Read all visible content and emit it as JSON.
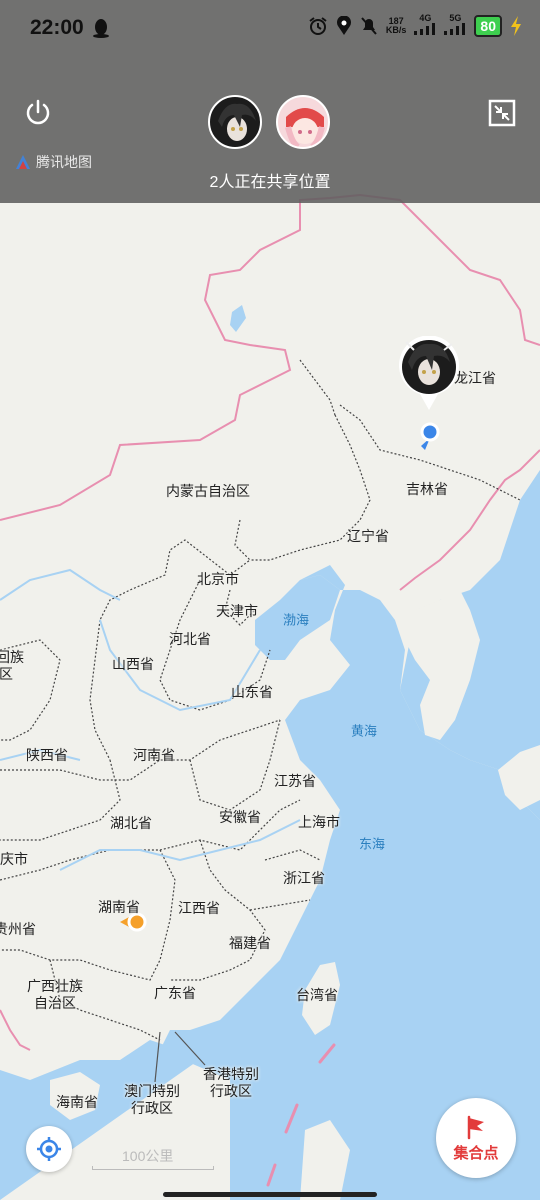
{
  "status_bar": {
    "time": "22:00",
    "net_speed_value": "187",
    "net_speed_unit": "KB/s",
    "signal1": "4G",
    "signal2": "5G",
    "battery": "80"
  },
  "header": {
    "share_text": "2人正在共享位置",
    "logo_text": "腾讯地图"
  },
  "map": {
    "labels": {
      "heilongjiang": "龙江省",
      "jilin": "吉林省",
      "neimenggu": "内蒙古自治区",
      "liaoning": "辽宁省",
      "beijing": "北京市",
      "tianjin": "天津市",
      "bohai": "渤海",
      "hebei": "河北省",
      "shanxi": "山西省",
      "ningxia_part1": "回族",
      "ningxia_part2": "区",
      "shandong": "山东省",
      "huanghai": "黄海",
      "shaanxi": "陕西省",
      "henan": "河南省",
      "jiangsu": "江苏省",
      "hubei": "湖北省",
      "anhui": "安徽省",
      "shanghai": "上海市",
      "donghai": "东海",
      "chongqing": "庆市",
      "zhejiang": "浙江省",
      "hunan": "湖南省",
      "jiangxi": "江西省",
      "guizhou": "贵州省",
      "fujian": "福建省",
      "guangxi_1": "广西壮族",
      "guangxi_2": "自治区",
      "guangdong": "广东省",
      "taiwan": "台湾省",
      "hongkong_1": "香港特别",
      "hongkong_2": "行政区",
      "macau_1": "澳门特别",
      "macau_2": "行政区",
      "hainan": "海南省"
    },
    "scale_label": "100公里"
  },
  "controls": {
    "rally_label": "集合点"
  },
  "colors": {
    "land": "#f1f1ec",
    "sea": "#a8d2f3",
    "border": "#e88fb0",
    "overlay": "#5f5f5f",
    "accent_blue": "#3b86e8",
    "accent_orange": "#f5a02a",
    "rally_red": "#e23b3b"
  }
}
